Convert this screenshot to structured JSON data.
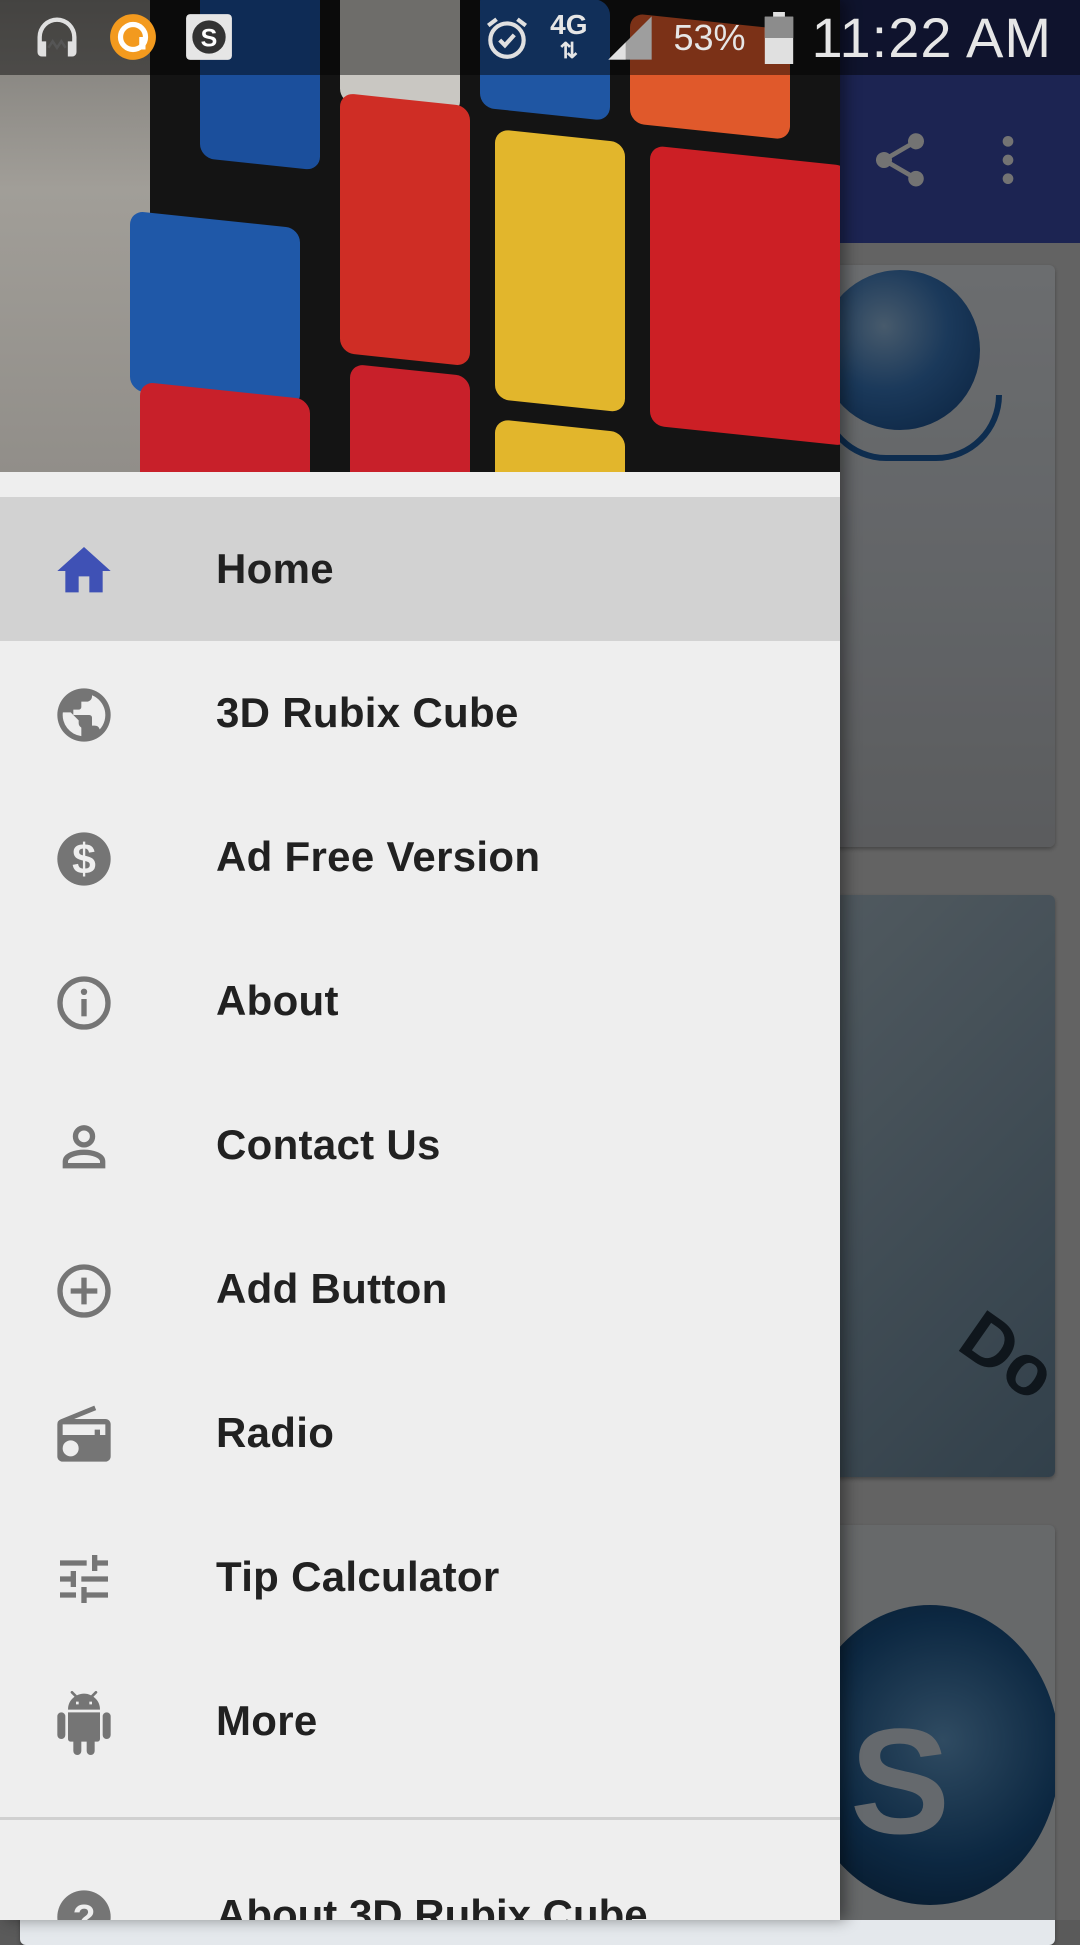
{
  "status_bar": {
    "network": "4G",
    "battery": "53%",
    "time": "11:22 AM",
    "icons": [
      "headphones-icon",
      "audible-icon",
      "app-s-icon",
      "alarm-icon",
      "signal-icon",
      "battery-icon"
    ]
  },
  "app_bar": {
    "actions": [
      "share-icon",
      "more-vert-icon"
    ]
  },
  "drawer": {
    "header_image": "rubiks-cube-photo",
    "items": [
      {
        "label": "Home",
        "icon": "home-icon",
        "active": true
      },
      {
        "label": "3D Rubix Cube",
        "icon": "globe-icon"
      },
      {
        "label": "Ad Free Version",
        "icon": "dollar-icon"
      },
      {
        "label": "About",
        "icon": "info-icon"
      },
      {
        "label": "Contact Us",
        "icon": "person-icon"
      },
      {
        "label": "Add Button",
        "icon": "add-circle-icon"
      },
      {
        "label": "Radio",
        "icon": "radio-icon"
      },
      {
        "label": "Tip Calculator",
        "icon": "tune-icon"
      },
      {
        "label": "More",
        "icon": "android-icon"
      }
    ],
    "footer": {
      "label": "About 3D Rubix Cube",
      "icon": "help-icon"
    }
  },
  "colors": {
    "primary": "#3f51b5",
    "active_icon": "#3f51b5",
    "icon": "#757575",
    "drawer_bg": "#eeeeee",
    "active_bg": "#d2d2d2"
  }
}
